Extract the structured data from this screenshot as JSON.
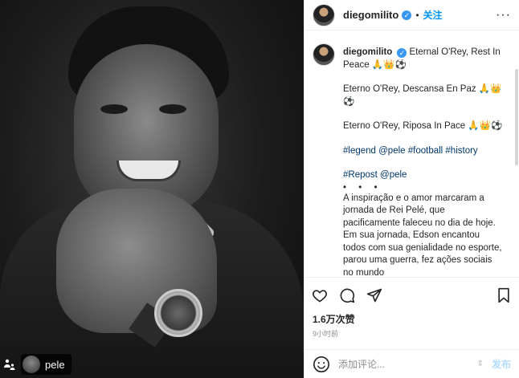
{
  "photo": {
    "tagged_user": "pele"
  },
  "header": {
    "username": "diegomilito",
    "separator": "•",
    "follow_label": "关注",
    "more_label": "···"
  },
  "caption": {
    "username": "diegomilito",
    "paragraphs": [
      "Eternal O'Rey, Rest In Peace 🙏👑⚽",
      "Eterno O'Rey, Descansa En Paz 🙏👑⚽",
      "Eterno O'Rey, Riposa In Pace 🙏👑⚽"
    ],
    "hashtags": "#legend @pele #football #history",
    "repost": "#Repost @pele",
    "dots": "• • •",
    "body": "A inspiração e o amor marcaram a jornada de Rei Pelé, que pacificamente faleceu no dia de hoje. Em sua jornada, Edson encantou todos com sua genialidade no esporte, parou uma guerra, fez ações sociais no mundo"
  },
  "stats": {
    "likes": "1.6万次赞",
    "time": "9小时前"
  },
  "comment": {
    "placeholder": "添加评论...",
    "post_label": "发布"
  },
  "colors": {
    "accent": "#0095f6",
    "post_disabled": "#b3dbff",
    "verified": "#3897f0"
  }
}
